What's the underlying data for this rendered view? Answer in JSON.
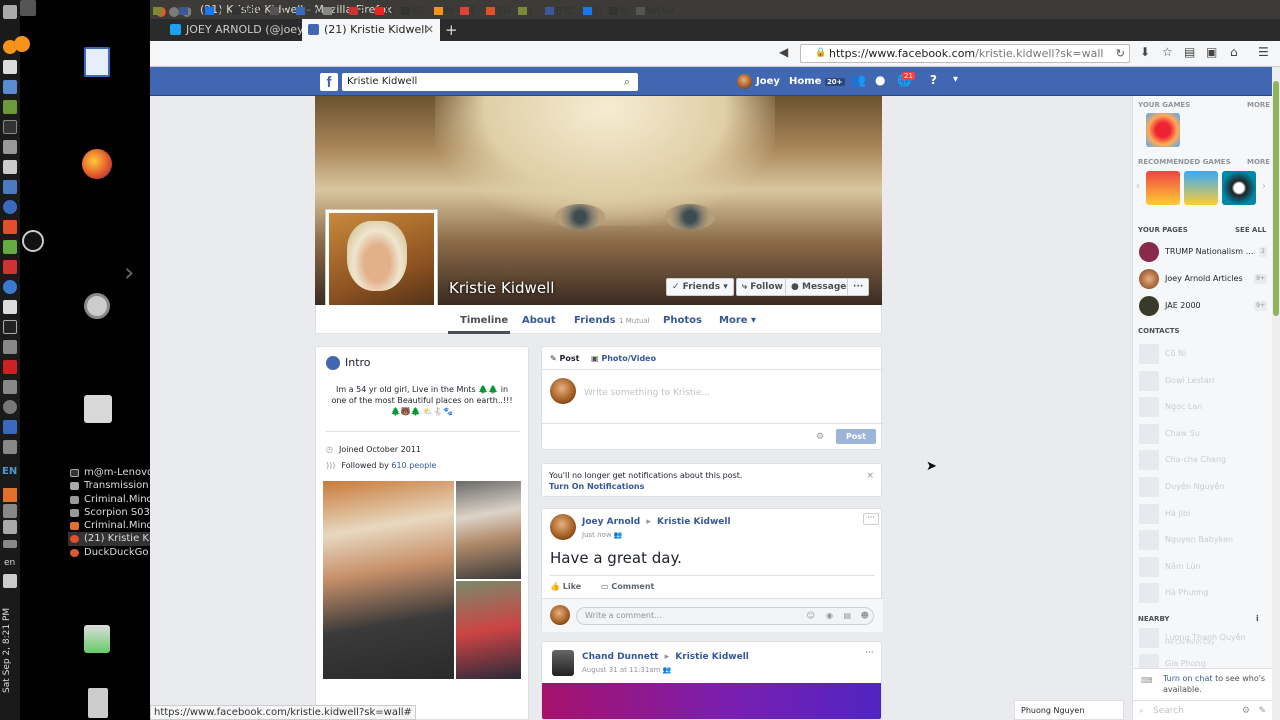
{
  "titlebar": {
    "title": "(21) Kristie Kidwell - Mozilla Firefox"
  },
  "tabs": [
    {
      "label": "JOEY ARNOLD (@joey",
      "active": false
    },
    {
      "label": "(21) Kristie Kidwell",
      "active": true
    }
  ],
  "bookmarks": [
    "!",
    "J",
    "m",
    "NEW",
    "T",
    "W",
    "J",
    "R",
    "H",
    "SC",
    "M",
    "E",
    "EB",
    "J",
    "BTC",
    "G",
    "G",
    "WOW"
  ],
  "url": {
    "domain": "https://www.facebook.com",
    "path": "/kristie.kidwell?sk=wall"
  },
  "desktop": {
    "lang": "EN",
    "lang_small": "en",
    "clock": "Sat Sep 2, 8:21 PM",
    "windows": [
      "m@m-Lenovo-...",
      "Transmission",
      "Criminal.Minds...",
      "Scorpion S03 S...",
      "Criminal.Minds...",
      "(21) Kristie Kid...",
      "DuckDuckGo - ..."
    ]
  },
  "fb": {
    "search_value": "Kristie Kidwell",
    "user": "Joey",
    "home": "Home",
    "home_badge": "20+",
    "notif_badge": "21",
    "logo": "f"
  },
  "profile": {
    "name": "Kristie Kidwell",
    "friends_btn": "✓ Friends ▾",
    "follow_btn": "Follow",
    "message_btn": "Message",
    "more_btn": "···",
    "tabs": {
      "timeline": "Timeline",
      "about": "About",
      "friends": "Friends",
      "friends_mutual": "1 Mutual",
      "photos": "Photos",
      "more": "More ▾"
    }
  },
  "intro": {
    "title": "Intro",
    "bio": "Im a 54 yr old girl, Live in the Mnts 🌲🌲 in one of the most Beautiful places on earth..!!!🌲🐻🌲 ⛅🐇🐾",
    "joined": "Joined October 2011",
    "followed_prefix": "Followed by",
    "followed_count": "610 people"
  },
  "composer": {
    "post_tab": "Post",
    "photo_tab": "Photo/Video",
    "placeholder": "Write something to Kristie...",
    "post_btn": "Post"
  },
  "notice": {
    "text": "You'll no longer get notifications about this post.",
    "link": "Turn On Notifications",
    "close": "×"
  },
  "post1": {
    "author": "Joey Arnold",
    "arrow": "▸",
    "target": "Kristie Kidwell",
    "time": "Just now",
    "text": "Have a great day.",
    "like": "Like",
    "comment": "Comment",
    "comment_placeholder": "Write a comment..."
  },
  "post2": {
    "author": "Chand Dunnett",
    "arrow": "▸",
    "target": "Kristie Kidwell",
    "time": "August 31 at 11:31am"
  },
  "right": {
    "your_games": "YOUR GAMES",
    "recommended_games": "RECOMMENDED GAMES",
    "more": "MORE",
    "your_pages": "YOUR PAGES",
    "see_all": "SEE ALL",
    "pages": [
      {
        "name": "TRUMP Nationalism ...",
        "count": "2"
      },
      {
        "name": "Joey Arnold Articles",
        "count": "9+"
      },
      {
        "name": "JAE 2000",
        "count": "9+"
      }
    ],
    "contacts_title": "CONTACTS",
    "contacts": [
      "Cô Nỉ",
      "Dowi Lestari",
      "Ngọc Lan",
      "Chaw Su",
      "Cha-cha Chang",
      "Duyên Nguyễn",
      "Hà Jibi",
      "Nguyen Babyken",
      "Nắm Lùn",
      "Hà Phương"
    ],
    "nearby_title": "NEARBY",
    "nearby": [
      {
        "name": "Lương Thanh Quyên",
        "sub": "Ho Chi Minh City"
      },
      {
        "name": "Gia Phong",
        "sub": ""
      }
    ],
    "chat_link": "Turn on chat",
    "chat_text": "to see who's available.",
    "search": "Search",
    "chat_name": "Phuong Nguyen"
  },
  "status_url": "https://www.facebook.com/kristie.kidwell?sk=wall#"
}
